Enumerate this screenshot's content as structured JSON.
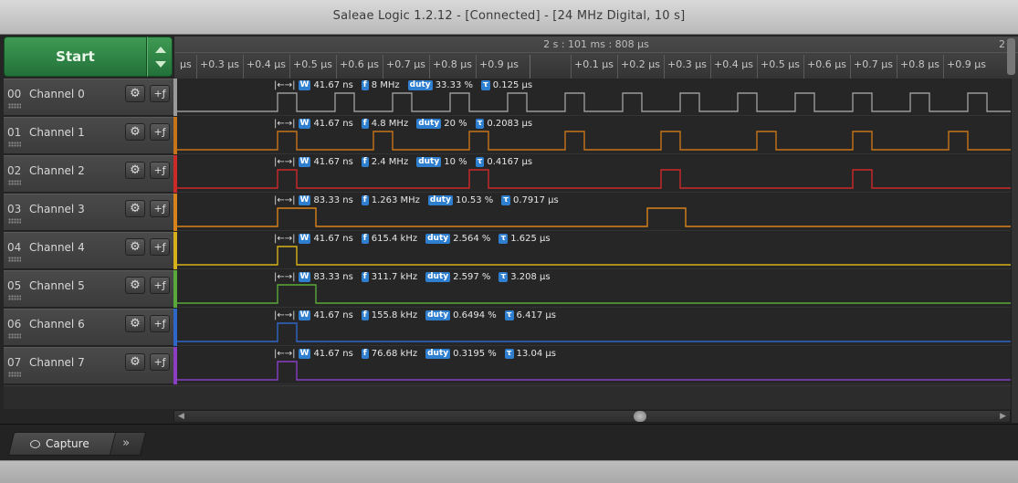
{
  "window": {
    "title": "Saleae Logic 1.2.12 - [Connected] - [24 MHz Digital, 10 s]"
  },
  "start": {
    "label": "Start"
  },
  "ruler": {
    "center_time": "2 s : 101 ms : 808 μs",
    "right_label": "2",
    "left_partial": "μs",
    "ticks_left": [
      "+0.3 μs",
      "+0.4 μs",
      "+0.5 μs",
      "+0.6 μs",
      "+0.7 μs",
      "+0.8 μs",
      "+0.9 μs"
    ],
    "ticks_right": [
      "+0.1 μs",
      "+0.2 μs",
      "+0.3 μs",
      "+0.4 μs",
      "+0.5 μs",
      "+0.6 μs",
      "+0.7 μs",
      "+0.8 μs",
      "+0.9 μs"
    ]
  },
  "colors": {
    "ch0": "#9a9a9a",
    "ch1": "#c77419",
    "ch2": "#cc2a2a",
    "ch3": "#d8821a",
    "ch4": "#d6b21a",
    "ch5": "#5aa83a",
    "ch6": "#2f67c9",
    "ch7": "#8a3ec4",
    "badge": "#2f7fd0"
  },
  "badges": {
    "width": "W",
    "freq": "f",
    "duty": "duty",
    "period": "τ"
  },
  "channels": [
    {
      "num": "00",
      "name": "Channel 0",
      "width": "41.67 ns",
      "freq": "8 MHz",
      "duty": "33.33 %",
      "period": "0.125 μs"
    },
    {
      "num": "01",
      "name": "Channel 1",
      "width": "41.67 ns",
      "freq": "4.8 MHz",
      "duty": "20 %",
      "period": "0.2083 μs"
    },
    {
      "num": "02",
      "name": "Channel 2",
      "width": "41.67 ns",
      "freq": "2.4 MHz",
      "duty": "10 %",
      "period": "0.4167 μs"
    },
    {
      "num": "03",
      "name": "Channel 3",
      "width": "83.33 ns",
      "freq": "1.263 MHz",
      "duty": "10.53 %",
      "period": "0.7917 μs"
    },
    {
      "num": "04",
      "name": "Channel 4",
      "width": "41.67 ns",
      "freq": "615.4 kHz",
      "duty": "2.564 %",
      "period": "1.625 μs"
    },
    {
      "num": "05",
      "name": "Channel 5",
      "width": "83.33 ns",
      "freq": "311.7 kHz",
      "duty": "2.597 %",
      "period": "3.208 μs"
    },
    {
      "num": "06",
      "name": "Channel 6",
      "width": "41.67 ns",
      "freq": "155.8 kHz",
      "duty": "0.6494 %",
      "period": "6.417 μs"
    },
    {
      "num": "07",
      "name": "Channel 7",
      "width": "41.67 ns",
      "freq": "76.68 kHz",
      "duty": "0.3195 %",
      "period": "13.04 μs"
    }
  ],
  "tabs": {
    "capture": "Capture",
    "more": "»"
  }
}
